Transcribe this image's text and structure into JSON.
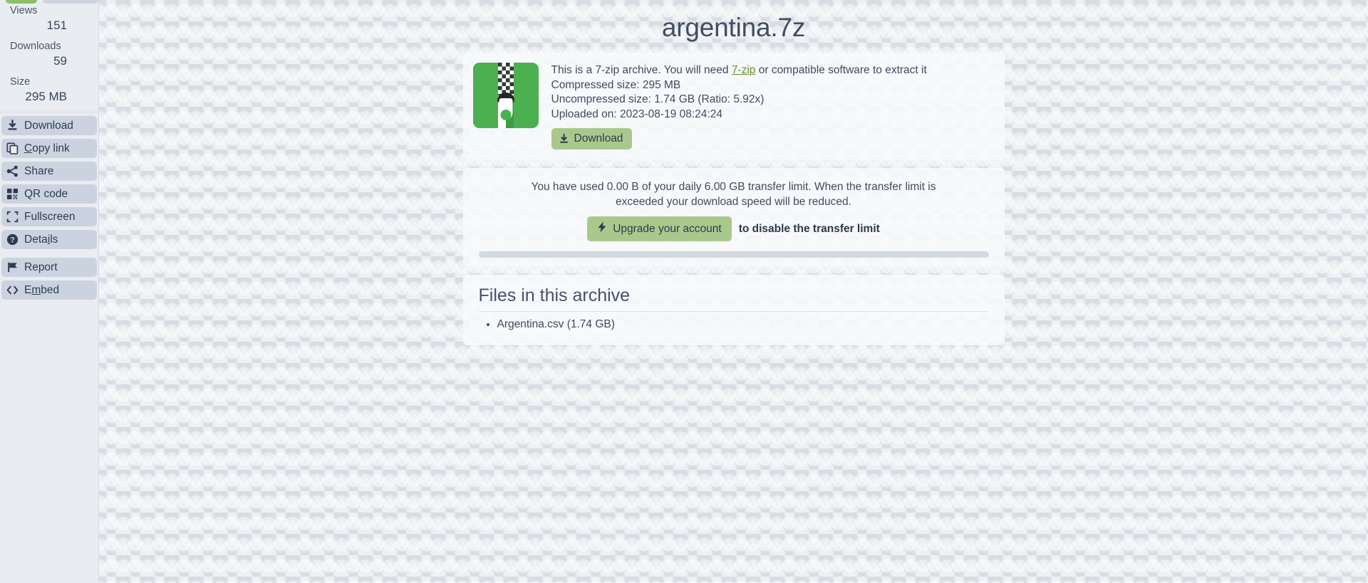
{
  "sidebar": {
    "stats": [
      {
        "label": "Views",
        "value": "151"
      },
      {
        "label": "Downloads",
        "value": "59"
      },
      {
        "label": "Size",
        "value": "295 MB"
      }
    ],
    "buttons": [
      {
        "icon": "download-icon",
        "label": "Download",
        "name": "download"
      },
      {
        "icon": "copy-icon",
        "label": "Copy link",
        "name": "copy-link",
        "accel": "C"
      },
      {
        "icon": "share-icon",
        "label": "Share",
        "name": "share"
      },
      {
        "icon": "qr-code-icon",
        "label": "QR code",
        "name": "qr-code"
      },
      {
        "icon": "fullscreen-icon",
        "label": "Fullscreen",
        "name": "fullscreen"
      },
      {
        "icon": "help-circle-icon",
        "label": "Details",
        "name": "details",
        "accel": "i"
      },
      {
        "icon": "flag-icon",
        "label": "Report",
        "name": "report"
      },
      {
        "icon": "code-brackets-icon",
        "label": "Embed",
        "name": "embed",
        "accel": "m"
      }
    ]
  },
  "main": {
    "title": "argentina.7z",
    "archive": {
      "icon": "zip-archive-icon",
      "description_before": "This is a 7-zip archive. You will need ",
      "link_label": "7-zip",
      "description_after": " or compatible software to extract it",
      "compressed": "Compressed size: 295 MB",
      "uncompressed": "Uncompressed size: 1.74 GB (Ratio: 5.92x)",
      "uploaded": "Uploaded on: 2023-08-19 08:24:24",
      "download_label": "Download"
    },
    "transfer": {
      "message": "You have used 0.00 B of your daily 6.00 GB transfer limit. When the transfer limit is exceeded your download speed will be reduced.",
      "upgrade_label": "Upgrade your account",
      "upgrade_suffix": "to disable the transfer limit",
      "progress_percent": 0
    },
    "files": {
      "heading": "Files in this archive",
      "items": [
        "Argentina.csv (1.74 GB)"
      ]
    }
  },
  "colors": {
    "accent_green": "#8fbf6a",
    "button_green": "#a9c98c",
    "zip_green": "#4caf50",
    "link_green": "#6b8f2c",
    "sidebar_button": "#ccd3e0",
    "text_dark": "#3f4b5e"
  }
}
